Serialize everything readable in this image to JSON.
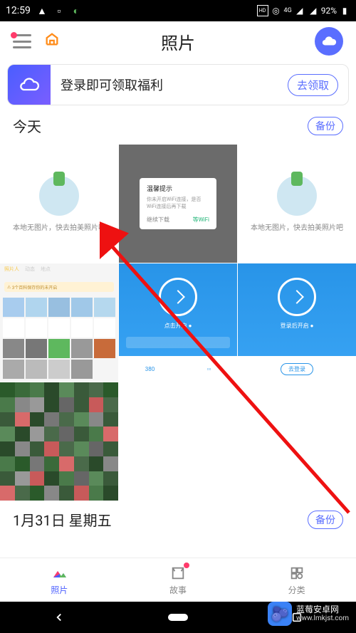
{
  "statusbar": {
    "time": "12:59",
    "network": "4G",
    "battery_pct": "92%"
  },
  "header": {
    "title": "照片"
  },
  "banner": {
    "text": "登录即可领取福利",
    "action": "去领取"
  },
  "sections": {
    "today": {
      "title": "今天",
      "backup": "备份"
    },
    "jan31": {
      "title": "1月31日 星期五",
      "backup": "备份"
    }
  },
  "thumbs": {
    "placeholder_text": "本地无图片，快去拍美照片吧",
    "dialog": {
      "title": "温馨提示",
      "body": "你未开启WiFi连接，是否WiFi连接后再下载",
      "cancel": "继续下载",
      "ok": "等WiFi"
    },
    "app": {
      "tab1": "照片人",
      "tab2": "动态",
      "tab3": "地点",
      "bar": "3个百科保存你的未开启"
    },
    "blue1": {
      "label": "点击开启",
      "stat": "380"
    },
    "blue2": {
      "label": "登录后开启",
      "btn": "去登录"
    }
  },
  "nav": {
    "photos": "照片",
    "stories": "故事",
    "categories": "分类"
  },
  "watermark": {
    "name": "蓝莓安卓网",
    "url": "www.lmkjst.com"
  }
}
